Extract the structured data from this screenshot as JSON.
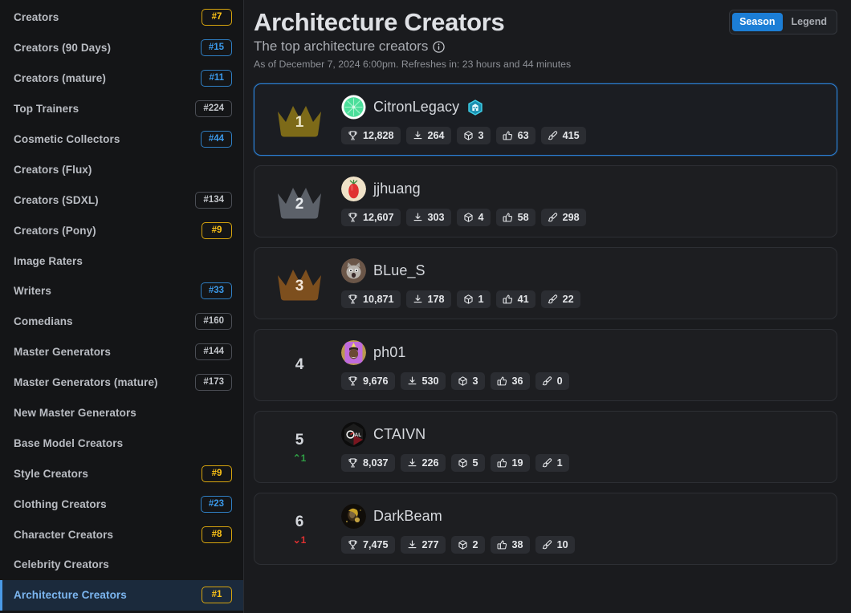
{
  "sidebar": {
    "items": [
      {
        "label": "Creators",
        "rank": "#7",
        "tier": "gold",
        "active": false
      },
      {
        "label": "Creators (90 Days)",
        "rank": "#15",
        "tier": "blue",
        "active": false
      },
      {
        "label": "Creators (mature)",
        "rank": "#11",
        "tier": "blue",
        "active": false
      },
      {
        "label": "Top Trainers",
        "rank": "#224",
        "tier": "gray",
        "active": false
      },
      {
        "label": "Cosmetic Collectors",
        "rank": "#44",
        "tier": "blue",
        "active": false
      },
      {
        "label": "Creators (Flux)",
        "rank": "",
        "tier": "none",
        "active": false
      },
      {
        "label": "Creators (SDXL)",
        "rank": "#134",
        "tier": "gray",
        "active": false
      },
      {
        "label": "Creators (Pony)",
        "rank": "#9",
        "tier": "gold",
        "active": false
      },
      {
        "label": "Image Raters",
        "rank": "",
        "tier": "none",
        "active": false
      },
      {
        "label": "Writers",
        "rank": "#33",
        "tier": "blue",
        "active": false
      },
      {
        "label": "Comedians",
        "rank": "#160",
        "tier": "gray",
        "active": false
      },
      {
        "label": "Master Generators",
        "rank": "#144",
        "tier": "gray",
        "active": false
      },
      {
        "label": "Master Generators (mature)",
        "rank": "#173",
        "tier": "gray",
        "active": false
      },
      {
        "label": "New Master Generators",
        "rank": "",
        "tier": "none",
        "active": false
      },
      {
        "label": "Base Model Creators",
        "rank": "",
        "tier": "none",
        "active": false
      },
      {
        "label": "Style Creators",
        "rank": "#9",
        "tier": "gold",
        "active": false
      },
      {
        "label": "Clothing Creators",
        "rank": "#23",
        "tier": "blue",
        "active": false
      },
      {
        "label": "Character Creators",
        "rank": "#8",
        "tier": "gold",
        "active": false
      },
      {
        "label": "Celebrity Creators",
        "rank": "",
        "tier": "none",
        "active": false
      },
      {
        "label": "Architecture Creators",
        "rank": "#1",
        "tier": "gold",
        "active": true
      }
    ]
  },
  "header": {
    "title": "Architecture Creators",
    "subtitle": "The top architecture creators",
    "info_icon": "info-icon",
    "as_of": "As of December 7, 2024 6:00pm. Refreshes in: 23 hours and 44 minutes",
    "toggle": {
      "options": [
        {
          "label": "Season",
          "active": true
        },
        {
          "label": "Legend",
          "active": false
        }
      ]
    }
  },
  "leaderboard": {
    "stat_icons": [
      "trophy-icon",
      "download-icon",
      "cube-icon",
      "thumbs-up-icon",
      "brush-icon"
    ],
    "entries": [
      {
        "rank": "1",
        "crown": "gold",
        "username": "CitronLegacy",
        "avatar": "citron-avatar",
        "badge": "architecture-badge",
        "delta": "",
        "delta_dir": "none",
        "highlighted": true,
        "stats": {
          "score": "12,828",
          "downloads": "264",
          "models": "3",
          "likes": "63",
          "images": "415"
        }
      },
      {
        "rank": "2",
        "crown": "silver",
        "username": "jjhuang",
        "avatar": "tomato-avatar",
        "badge": "",
        "delta": "",
        "delta_dir": "none",
        "highlighted": false,
        "stats": {
          "score": "12,607",
          "downloads": "303",
          "models": "4",
          "likes": "58",
          "images": "298"
        }
      },
      {
        "rank": "3",
        "crown": "bronze",
        "username": "BLue_S",
        "avatar": "cat-avatar",
        "badge": "",
        "delta": "",
        "delta_dir": "none",
        "highlighted": false,
        "stats": {
          "score": "10,871",
          "downloads": "178",
          "models": "1",
          "likes": "41",
          "images": "22"
        }
      },
      {
        "rank": "4",
        "crown": "none",
        "username": "ph01",
        "avatar": "purple-avatar",
        "badge": "",
        "delta": "",
        "delta_dir": "none",
        "highlighted": false,
        "stats": {
          "score": "9,676",
          "downloads": "530",
          "models": "3",
          "likes": "36",
          "images": "0"
        }
      },
      {
        "rank": "5",
        "crown": "none",
        "username": "CTAIVN",
        "avatar": "ctaivn-avatar",
        "badge": "",
        "delta": "1",
        "delta_dir": "up",
        "highlighted": false,
        "stats": {
          "score": "8,037",
          "downloads": "226",
          "models": "5",
          "likes": "19",
          "images": "1"
        }
      },
      {
        "rank": "6",
        "crown": "none",
        "username": "DarkBeam",
        "avatar": "darkbeam-avatar",
        "badge": "",
        "delta": "1",
        "delta_dir": "down",
        "highlighted": false,
        "stats": {
          "score": "7,475",
          "downloads": "277",
          "models": "2",
          "likes": "38",
          "images": "10"
        }
      }
    ]
  },
  "colors": {
    "accent_blue": "#1c7ed6",
    "gold": "#ffc517",
    "crown_gold": "#7d6a18",
    "crown_silver": "#5c6169",
    "crown_bronze": "#7d4f1e",
    "up_green": "#2f9e44",
    "down_red": "#e03131",
    "page_bg": "#1a1b1e",
    "sidebar_bg": "#141517",
    "card_bg": "#1d1e21"
  }
}
